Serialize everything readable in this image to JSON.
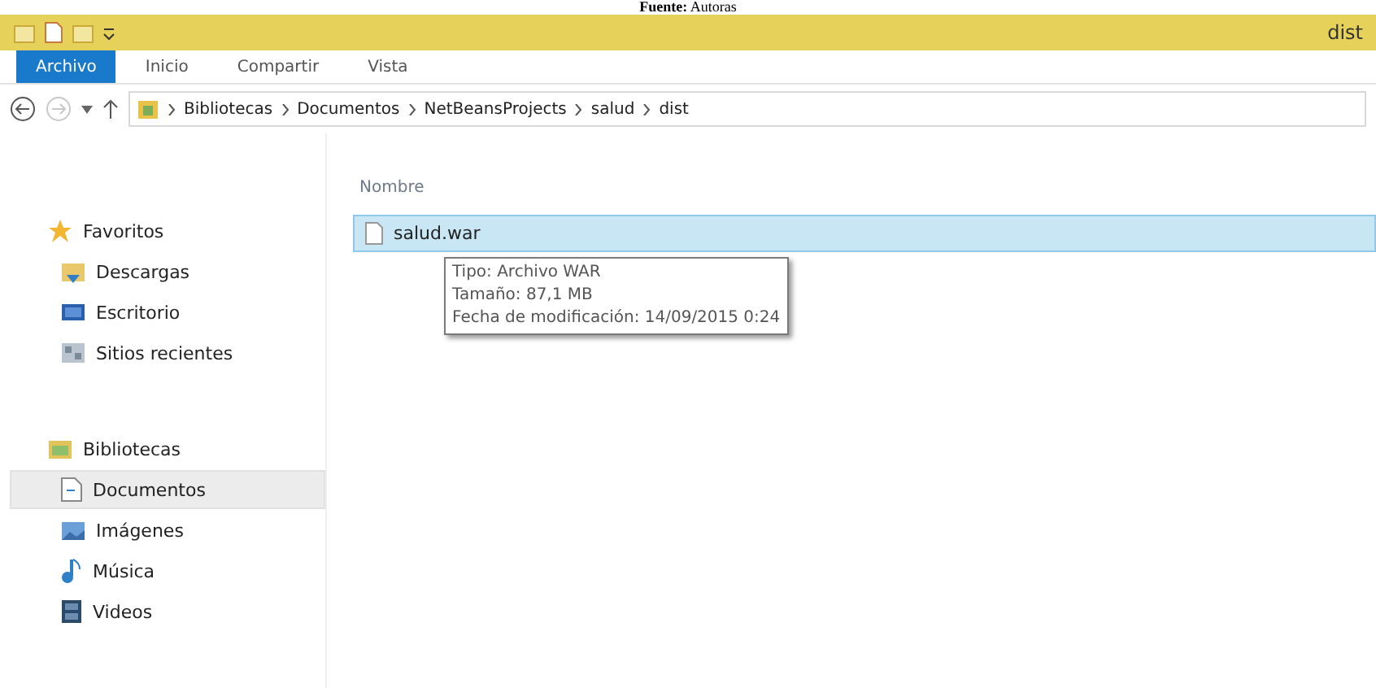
{
  "caption": "**Fuente:** Autoras",
  "window": {
    "title": "dist"
  },
  "ribbon_tabs": [
    {
      "label": "Archivo",
      "selected": true
    },
    {
      "label": "Inicio",
      "selected": false
    },
    {
      "label": "Compartir",
      "selected": false
    },
    {
      "label": "Vista",
      "selected": false
    }
  ],
  "address_bar": {
    "back_disabled": false,
    "forward_disabled": true,
    "path": [
      "Bibliotecas",
      "Documentos",
      "NetBeansProjects",
      "salud",
      "dist"
    ]
  },
  "sidebar": {
    "groups": [
      {
        "label": "Favoritos",
        "kind": "star",
        "children": [
          {
            "label": "Descargas",
            "kind": "download",
            "selected": false
          },
          {
            "label": "Escritorio",
            "kind": "desktop",
            "selected": false
          },
          {
            "label": "Sitios recientes",
            "kind": "recent",
            "selected": false
          }
        ]
      },
      {
        "label": "Bibliotecas",
        "kind": "library",
        "children": [
          {
            "label": "Documentos",
            "kind": "document",
            "selected": true
          },
          {
            "label": "Imágenes",
            "kind": "pictures",
            "selected": false
          },
          {
            "label": "Música",
            "kind": "music",
            "selected": false
          },
          {
            "label": "Videos",
            "kind": "video",
            "selected": false
          }
        ]
      }
    ]
  },
  "file_list": {
    "columns": [
      "Nombre"
    ],
    "rows": [
      {
        "name": "salud.war",
        "selected": true
      }
    ]
  },
  "tooltip": {
    "lines": [
      "Tipo: Archivo WAR",
      "Tamaño: 87,1 MB",
      "Fecha de modificación: 14/09/2015 0:24"
    ]
  }
}
